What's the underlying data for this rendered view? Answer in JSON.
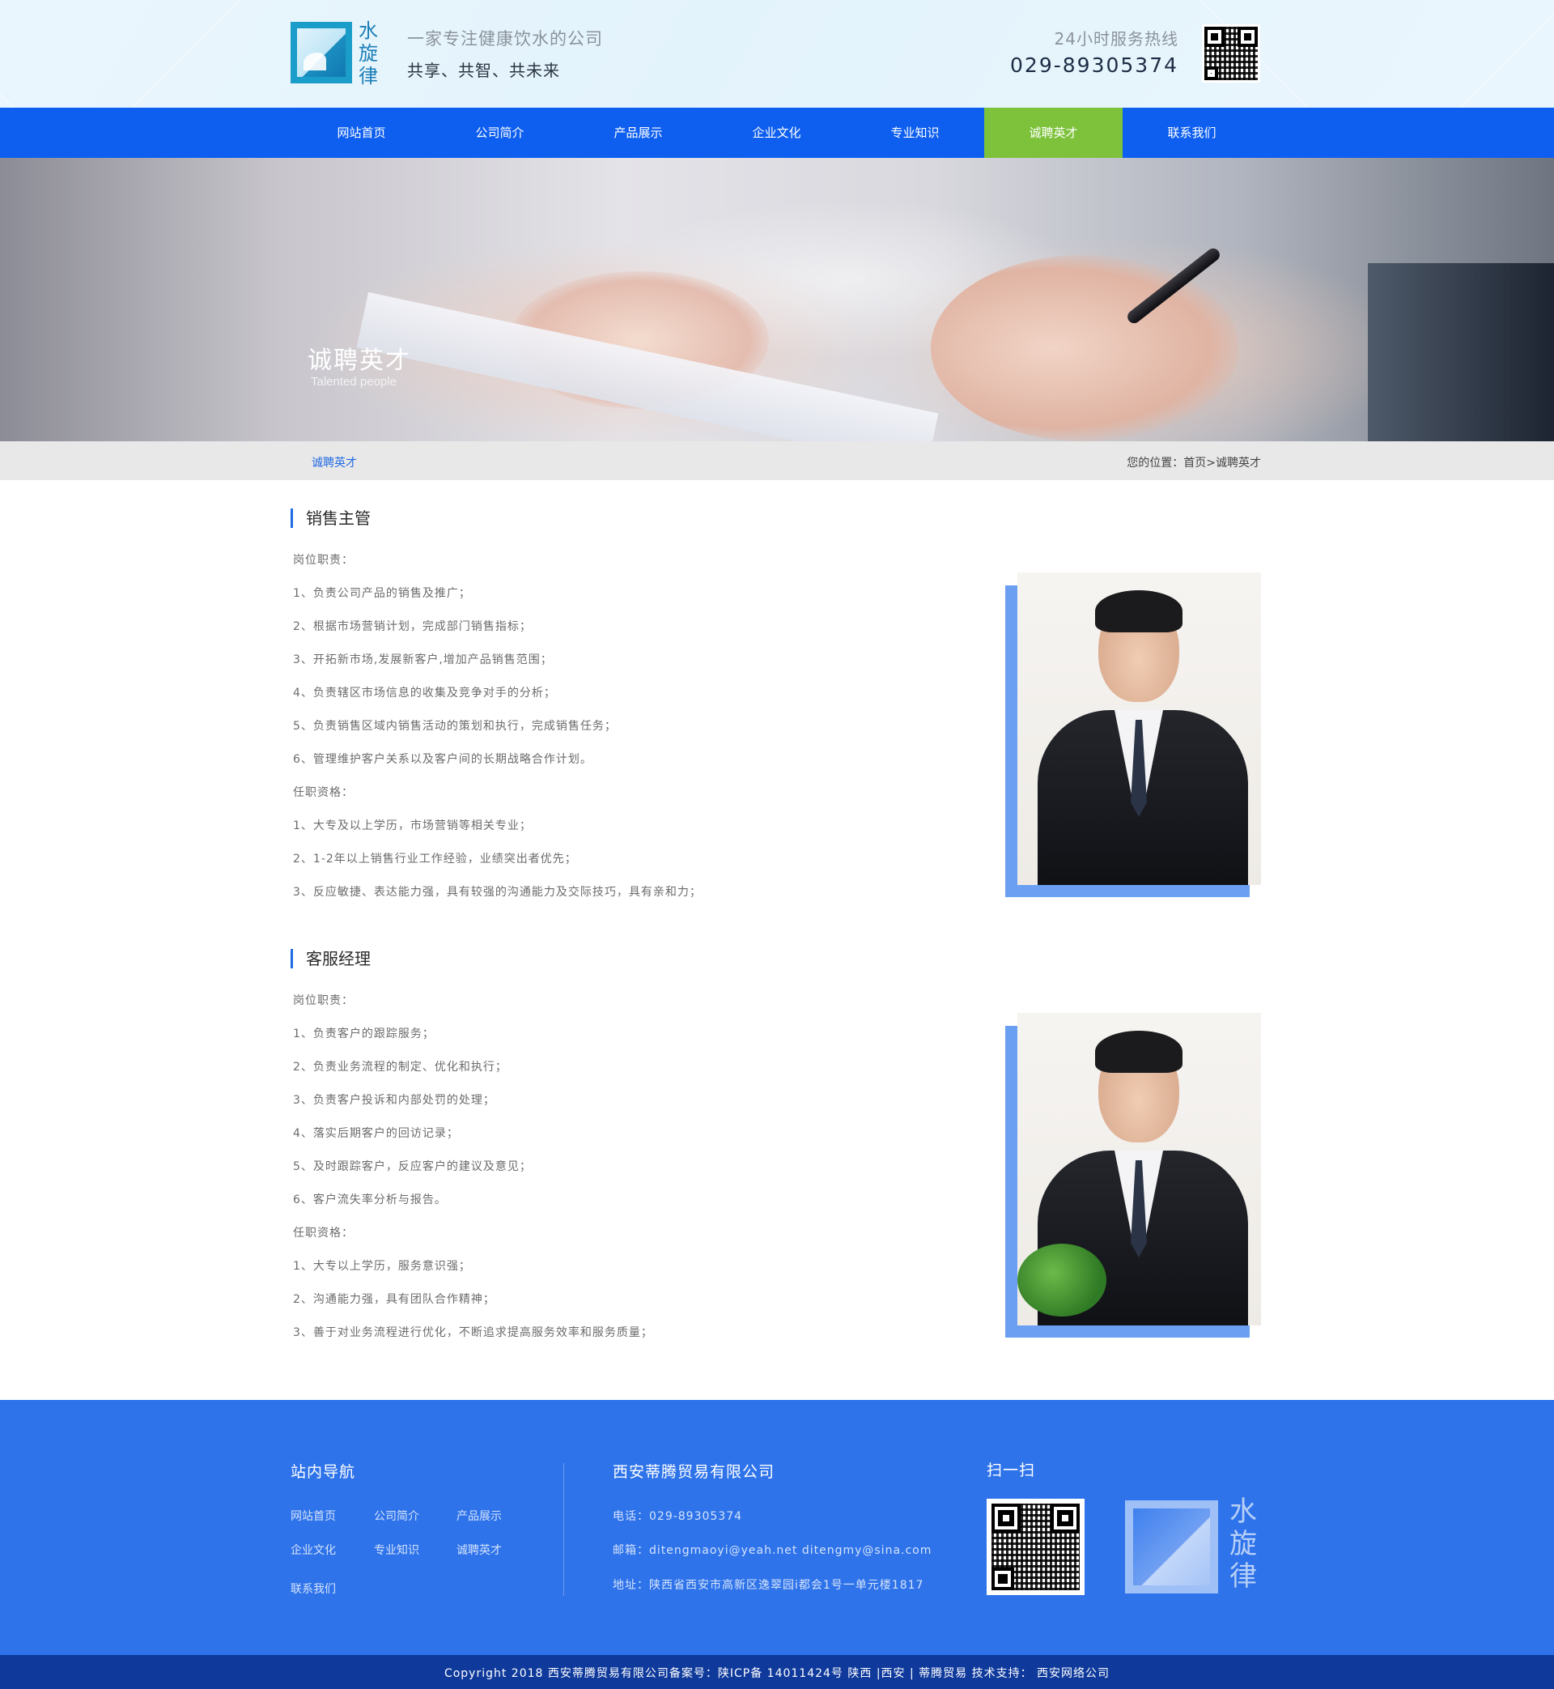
{
  "header": {
    "logo_text": "水旋律",
    "slogan_line1": "一家专注健康饮水的公司",
    "slogan_line2": "共享、共智、共未来",
    "hotline_label": "24小时服务热线",
    "hotline_number": "029-89305374",
    "qr_icon": "qr-code-icon"
  },
  "nav": {
    "items": [
      {
        "label": "网站首页",
        "active": false
      },
      {
        "label": "公司简介",
        "active": false
      },
      {
        "label": "产品展示",
        "active": false
      },
      {
        "label": "企业文化",
        "active": false
      },
      {
        "label": "专业知识",
        "active": false
      },
      {
        "label": "诚聘英才",
        "active": true
      },
      {
        "label": "联系我们",
        "active": false
      }
    ],
    "active_color": "#7dc23a",
    "bar_color": "#0e5ff0"
  },
  "banner": {
    "title": "诚聘英才",
    "subtitle": "Talented people"
  },
  "breadcrumb": {
    "current": "诚聘英才",
    "path": "您的位置：首页>诚聘英才"
  },
  "jobs": [
    {
      "title": "销售主管",
      "lines": [
        "岗位职责：",
        "1、负责公司产品的销售及推广；",
        "2、根据市场营销计划，完成部门销售指标；",
        "3、开拓新市场,发展新客户,增加产品销售范围；",
        "4、负责辖区市场信息的收集及竞争对手的分析；",
        "5、负责销售区域内销售活动的策划和执行，完成销售任务；",
        "6、管理维护客户关系以及客户间的长期战略合作计划。",
        "任职资格：",
        "1、大专及以上学历，市场营销等相关专业；",
        "2、1-2年以上销售行业工作经验，业绩突出者优先；",
        "3、反应敏捷、表达能力强，具有较强的沟通能力及交际技巧，具有亲和力；"
      ]
    },
    {
      "title": "客服经理",
      "lines": [
        "岗位职责：",
        "1、负责客户的跟踪服务；",
        "2、负责业务流程的制定、优化和执行；",
        "3、负责客户投诉和内部处罚的处理；",
        "4、落实后期客户的回访记录；",
        "5、及时跟踪客户，反应客户的建议及意见；",
        "6、客户流失率分析与报告。",
        "任职资格：",
        "1、大专以上学历，服务意识强；",
        "2、沟通能力强，具有团队合作精神；",
        "3、善于对业务流程进行优化，不断追求提高服务效率和服务质量；"
      ]
    }
  ],
  "footer": {
    "nav_heading": "站内导航",
    "nav_links": [
      "网站首页",
      "公司简介",
      "产品展示",
      "企业文化",
      "专业知识",
      "诚聘英才",
      "联系我们"
    ],
    "company_name": "西安蒂腾贸易有限公司",
    "phone": "电话：029-89305374",
    "email": "邮箱：ditengmaoyi@yeah.net  ditengmy@sina.com",
    "address": "地址：陕西省西安市高新区逸翠园i都会1号一单元楼1817",
    "scan_heading": "扫一扫",
    "logo_text": "水旋律",
    "copyright": "Copyright  2018 西安蒂腾贸易有限公司备案号：陕ICP备 14011424号    陕西 |西安 |  蒂腾贸易    技术支持： 西安网络公司"
  }
}
